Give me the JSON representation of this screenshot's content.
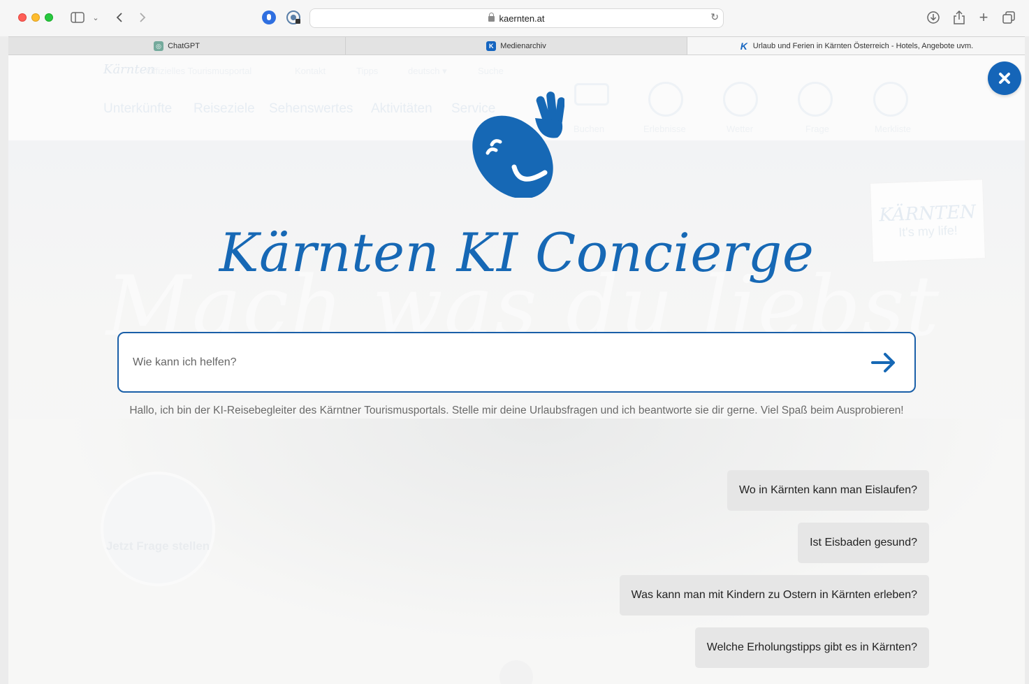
{
  "browser": {
    "url": "kaernten.at",
    "tabs": [
      {
        "label": "ChatGPT",
        "favicon": "chatgpt-icon"
      },
      {
        "label": "Medienarchiv",
        "favicon": "kaernten-k-icon"
      },
      {
        "label": "Urlaub und Ferien in Kärnten Österreich - Hotels, Angebote uvm.",
        "favicon": "kaernten-k-icon",
        "active": true
      }
    ]
  },
  "background_site": {
    "logo": "Kärnten",
    "tagline": "Offizielles Tourismusportal",
    "top_links": [
      "Kontakt",
      "Tipps",
      "deutsch ▾",
      "Suche"
    ],
    "nav": [
      "Unterkünfte",
      "Reiseziele",
      "Sehenswertes",
      "Aktivitäten",
      "Service"
    ],
    "icon_nav": [
      "Buchen",
      "Erlebnisse",
      "Wetter",
      "Frage",
      "Merkliste"
    ],
    "hero_script": "Mach was du liebst",
    "badge": {
      "title": "KÄRNTEN",
      "subtitle": "It's my life!"
    },
    "ask_circle": "Jetzt Frage stellen"
  },
  "overlay": {
    "title": "Kärnten KI Concierge",
    "search_placeholder": "Wie kann ich helfen?",
    "intro": "Hallo, ich bin der KI-Reisebegleiter des Kärntner Tourismusportals. Stelle mir deine Urlaubsfragen und ich beantworte sie dir gerne. Viel Spaß beim Ausprobieren!",
    "suggestions": [
      "Wo in Kärnten kann man Eislaufen?",
      "Ist Eisbaden gesund?",
      "Was kann man mit Kindern zu Ostern in Kärnten erleben?",
      "Welche Erholungstipps gibt es in Kärnten?"
    ]
  },
  "colors": {
    "brand_blue": "#1668b5",
    "suggestion_bg": "#e6e6e6"
  }
}
